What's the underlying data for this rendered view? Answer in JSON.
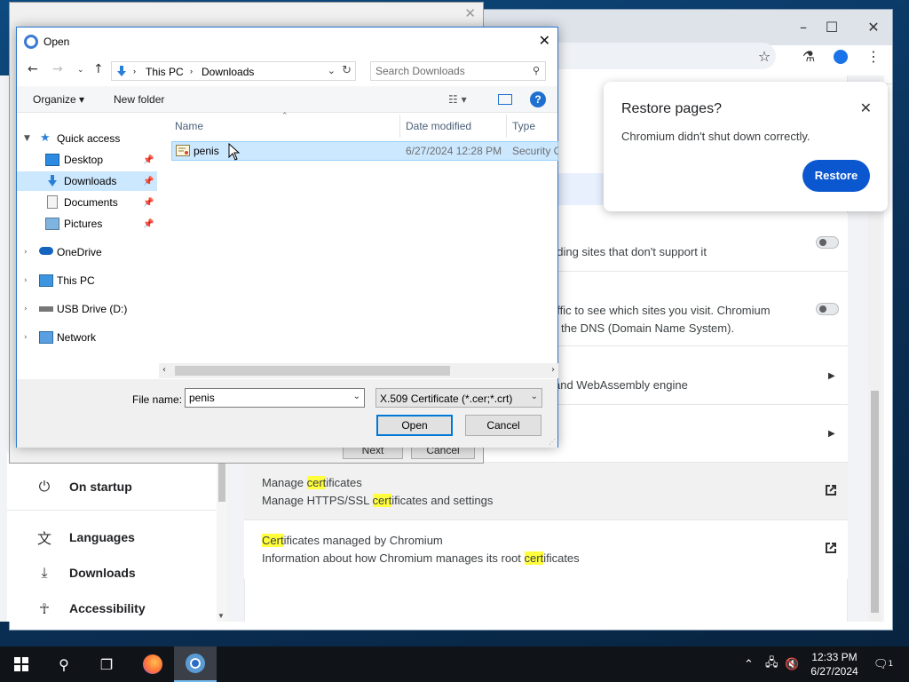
{
  "chromium": {
    "window_controls": [
      "–",
      "☐",
      "✕"
    ],
    "toolbar_icons": [
      "star-icon",
      "labs-icon",
      "profile-icon",
      "menu-icon"
    ],
    "settings_nav": [
      {
        "label": "On startup",
        "icon": "power-icon"
      },
      {
        "label": "Languages",
        "icon": "translate-icon"
      },
      {
        "label": "Downloads",
        "icon": "download-icon"
      },
      {
        "label": "Accessibility",
        "icon": "accessibility-icon"
      }
    ],
    "rows": {
      "r1_text": "ading sites that don't support it",
      "r2_line1": "affic to see which sites you visit. Chromium",
      "r2_line2": "the DNS (Domain Name System).",
      "r3_text": "and WebAssembly engine",
      "manage_cert": {
        "l1_a": "Manage ",
        "l1_hl": "cert",
        "l1_b": "ificates",
        "l2_a": "Manage HTTPS/SSL ",
        "l2_hl": "cert",
        "l2_b": "ificates and settings"
      },
      "managed_cert": {
        "l1_hl": "Cert",
        "l1_b": "ificates managed by Chromium",
        "l2_a": "Information about how Chromium manages its root ",
        "l2_hl": "cert",
        "l2_b": "ificates"
      }
    },
    "restore_bubble": {
      "title": "Restore pages?",
      "message": "Chromium didn't shut down correctly.",
      "button": "Restore",
      "close": "✕"
    }
  },
  "wizard_behind": {
    "next_label": "Next",
    "cancel_label": "Cancel"
  },
  "open_dialog": {
    "title": "Open",
    "close": "✕",
    "breadcrumb": [
      "This PC",
      "Downloads"
    ],
    "search_placeholder": "Search Downloads",
    "organize_label": "Organize ▾",
    "new_folder_label": "New folder",
    "help_label": "?",
    "tree": [
      {
        "label": "Quick access",
        "icon": "star-icon",
        "level": 0,
        "expanded": true
      },
      {
        "label": "Desktop",
        "icon": "desktop-icon",
        "level": 1,
        "pinned": true
      },
      {
        "label": "Downloads",
        "icon": "download-folder-icon",
        "level": 1,
        "pinned": true,
        "selected": true
      },
      {
        "label": "Documents",
        "icon": "documents-icon",
        "level": 1,
        "pinned": true
      },
      {
        "label": "Pictures",
        "icon": "pictures-icon",
        "level": 1,
        "pinned": true
      },
      {
        "label": "OneDrive",
        "icon": "cloud-icon",
        "level": 0
      },
      {
        "label": "This PC",
        "icon": "computer-icon",
        "level": 0
      },
      {
        "label": "USB Drive (D:)",
        "icon": "usb-drive-icon",
        "level": 0
      },
      {
        "label": "Network",
        "icon": "network-icon",
        "level": 0
      }
    ],
    "columns": [
      "Name",
      "Date modified",
      "Type"
    ],
    "files": [
      {
        "name": "penis",
        "date_modified": "6/27/2024 12:28 PM",
        "type": "Security Certificate",
        "icon": "certificate-file-icon"
      }
    ],
    "file_name_label": "File name:",
    "file_name_value": "penis",
    "file_type": "X.509 Certificate (*.cer;*.crt)",
    "open_label": "Open",
    "cancel_label": "Cancel"
  },
  "taskbar": {
    "apps": [
      "windows-start-icon",
      "search-icon",
      "task-view-icon",
      "firefox-icon",
      "chromium-icon"
    ],
    "time": "12:33 PM",
    "date": "6/27/2024",
    "tray_icons": [
      "chevron-up-icon",
      "network-tray-icon",
      "volume-muted-icon",
      "notification-icon"
    ],
    "notification_count": "1"
  },
  "colors": {
    "accent": "#0b57d0",
    "selection": "#cce8ff",
    "highlight": "#ffff3d"
  }
}
